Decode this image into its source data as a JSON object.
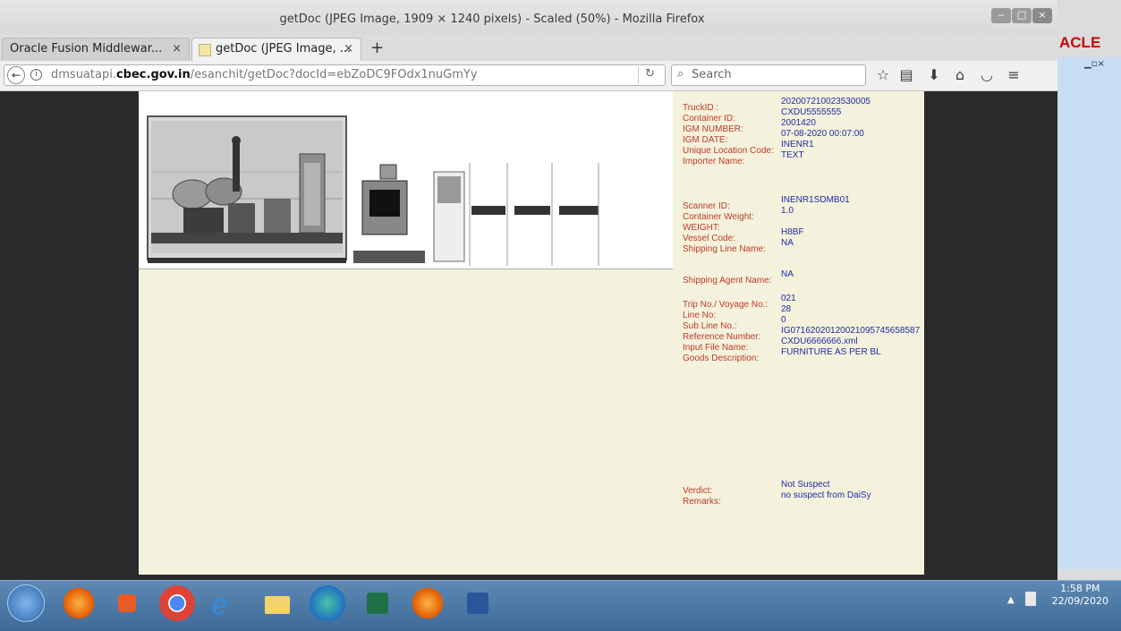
{
  "window": {
    "title": "getDoc (JPEG Image, 1909 × 1240 pixels) - Scaled (50%) - Mozilla Firefox"
  },
  "tabs": [
    {
      "label": "Oracle Fusion Middlewar...",
      "close": "×"
    },
    {
      "label": "getDoc (JPEG Image, ...",
      "close": "×"
    }
  ],
  "new_tab_label": "+",
  "nav": {
    "url_prefix": "dmsuatapi.",
    "url_domain": "cbec.gov.in",
    "url_path": "/esanchit/getDoc?docId=ebZoDC9FOdx1nuGmYy",
    "search_placeholder": "Search",
    "reload_icon": "reload-icon",
    "back_icon": "back-arrow-icon"
  },
  "side_window": {
    "logo_text": "ACLE"
  },
  "document": {
    "fields_group1": [
      {
        "label": "TruckID :",
        "value": "202007210023530005"
      },
      {
        "label": "Container ID:",
        "value": "CXDU5555555"
      },
      {
        "label": "IGM NUMBER:",
        "value": "2001420"
      },
      {
        "label": "IGM DATE:",
        "value": "07-08-2020 00:07:00"
      },
      {
        "label": "Unique Location Code:",
        "value": "INENR1"
      },
      {
        "label": "Importer Name:",
        "value": "TEXT"
      }
    ],
    "fields_group2": [
      {
        "label": "Scanner ID:",
        "value": "INENR1SDMB01"
      },
      {
        "label": "Container Weight:",
        "value": "1.0"
      },
      {
        "label": "WEIGHT:",
        "value": ""
      },
      {
        "label": "Vessel Code:",
        "value": "H8BF"
      },
      {
        "label": "Shipping Line Name:",
        "value": "NA"
      }
    ],
    "fields_group3": [
      {
        "label": "Shipping Agent Name:",
        "value": "NA"
      }
    ],
    "fields_group4": [
      {
        "label": "Trip No./ Voyage No.:",
        "value": "021"
      },
      {
        "label": "Line No:",
        "value": "28"
      },
      {
        "label": "Sub Line No.:",
        "value": "0"
      },
      {
        "label": "Reference Number:",
        "value": "IG071620201200210957456585​87"
      },
      {
        "label": "Input File Name:",
        "value": "CXDU6666666.xml"
      },
      {
        "label": "Goods Description:",
        "value": "FURNITURE AS PER BL"
      }
    ],
    "fields_group5": [
      {
        "label": "Verdict:",
        "value": "Not Suspect"
      },
      {
        "label": "Remarks:",
        "value": "no suspect from DaiSy"
      }
    ]
  },
  "taskbar": {
    "time": "1:58 PM",
    "date": "22/09/2020"
  }
}
